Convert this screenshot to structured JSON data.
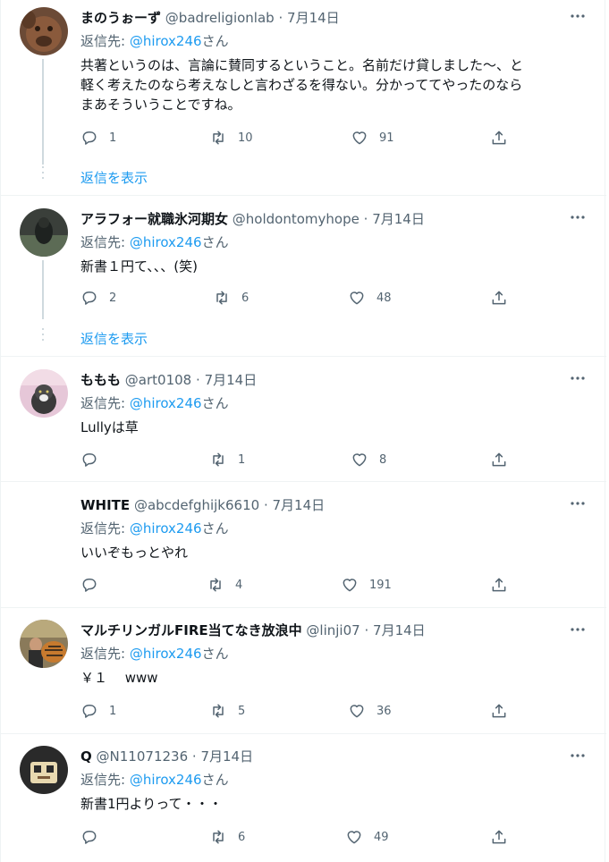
{
  "reply_prefix": "返信先: ",
  "reply_suffix": "さん",
  "separator": "·",
  "tweets": [
    {
      "name": "まのうぉーず",
      "handle": "@badreligionlab",
      "date": "7月14日",
      "reply_to": "@hirox246",
      "lines": [
        "共著というのは、言論に賛同するということ。名前だけ貸しました〜、と",
        "軽く考えたのなら考えなしと言わざるを得ない。分かっててやったのなら",
        "まあそういうことですね。"
      ],
      "replies": "1",
      "retweets": "10",
      "likes": "91",
      "show_replies": "返信を表示"
    },
    {
      "name": "アラフォー就職氷河期女",
      "handle": "@holdontomyhope",
      "date": "7月14日",
      "reply_to": "@hirox246",
      "lines": [
        "新書１円て、、、(笑)"
      ],
      "replies": "2",
      "retweets": "6",
      "likes": "48",
      "show_replies": "返信を表示"
    },
    {
      "name": "ももも",
      "handle": "@art0108",
      "date": "7月14日",
      "reply_to": "@hirox246",
      "lines": [
        "Lullyは草"
      ],
      "replies": "",
      "retweets": "1",
      "likes": "8"
    },
    {
      "name": "WHITE",
      "handle": "@abcdefghijk6610",
      "date": "7月14日",
      "reply_to": "@hirox246",
      "lines": [
        "いいぞもっとやれ"
      ],
      "replies": "",
      "retweets": "4",
      "likes": "191"
    },
    {
      "name": "マルチリンガルFIRE当てなき放浪中",
      "handle": "@linji07",
      "date": "7月14日",
      "reply_to": "@hirox246",
      "lines": [
        "￥１　 www"
      ],
      "replies": "1",
      "retweets": "5",
      "likes": "36"
    },
    {
      "name": "Q",
      "handle": "@N11071236",
      "date": "7月14日",
      "reply_to": "@hirox246",
      "lines": [
        "新書1円よりって・・・"
      ],
      "replies": "",
      "retweets": "6",
      "likes": "49"
    }
  ],
  "icons": {
    "reply": "reply-icon",
    "retweet": "retweet-icon",
    "like": "heart-icon",
    "share": "share-icon",
    "more": "more-icon"
  },
  "colors": {
    "link": "#1d9bf0",
    "secondary": "#536471",
    "border": "#eff3f4",
    "thread_line": "#cfd9de"
  }
}
